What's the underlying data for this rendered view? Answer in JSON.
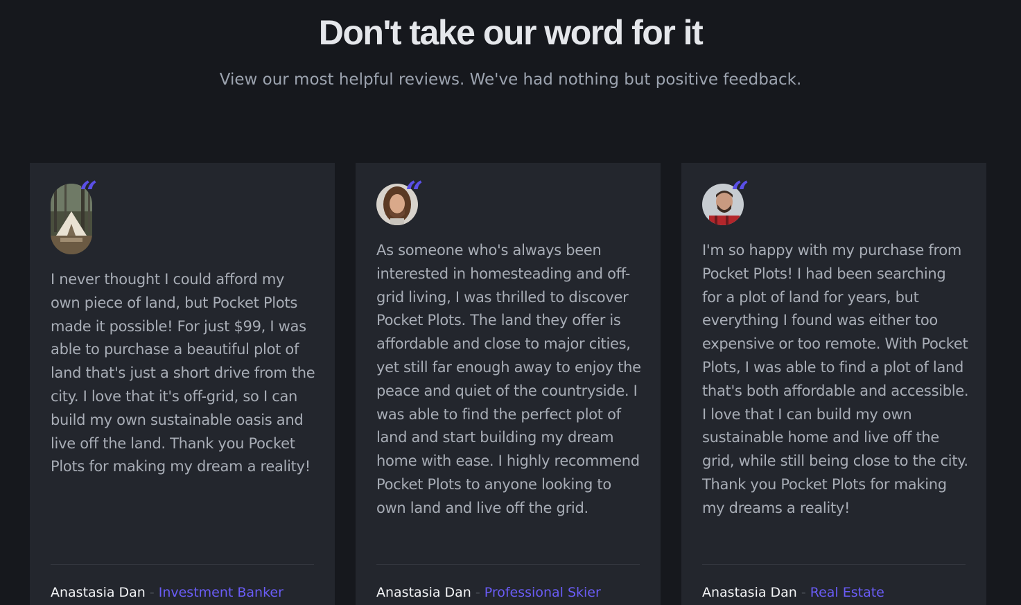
{
  "section": {
    "title": "Don't take our word for it",
    "subtitle": "View our most helpful reviews. We've had nothing but positive feedback."
  },
  "colors": {
    "background": "#16181d",
    "card": "#23262d",
    "accent": "#6a5cf6",
    "text": "#a8adb6"
  },
  "reviews": [
    {
      "avatar": "glamping-tent-photo",
      "quote_icon": "quote-icon",
      "quote_mark": "“",
      "text": "I never thought I could afford my own piece of land, but Pocket Plots made it possible! For just $99, I was able to purchase a beautiful plot of land that's just a short drive from the city. I love that it's off-grid, so I can build my own sustainable oasis and live off the land. Thank you Pocket Plots for making my dream a reality!",
      "author": "Anastasia Dan",
      "separator": "-",
      "role": "Investment Banker"
    },
    {
      "avatar": "long-haired-man-portrait",
      "quote_icon": "quote-icon",
      "quote_mark": "“",
      "text": "As someone who's always been interested in homesteading and off-grid living, I was thrilled to discover Pocket Plots. The land they offer is affordable and close to major cities, yet still far enough away to enjoy the peace and quiet of the countryside. I was able to find the perfect plot of land and start building my dream home with ease. I highly recommend Pocket Plots to anyone looking to own land and live off the grid.",
      "author": "Anastasia Dan",
      "separator": "-",
      "role": "Professional Skier"
    },
    {
      "avatar": "bearded-man-portrait",
      "quote_icon": "quote-icon",
      "quote_mark": "“",
      "text": "I'm so happy with my purchase from Pocket Plots! I had been searching for a plot of land for years, but everything I found was either too expensive or too remote. With Pocket Plots, I was able to find a plot of land that's both affordable and accessible. I love that I can build my own sustainable home and live off the grid, while still being close to the city. Thank you Pocket Plots for making my dreams a reality!",
      "author": "Anastasia Dan",
      "separator": "-",
      "role": "Real Estate"
    }
  ]
}
